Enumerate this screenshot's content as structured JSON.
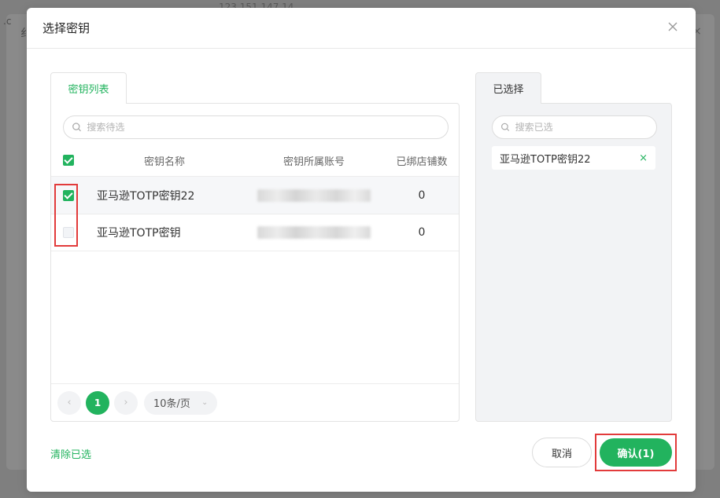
{
  "background": {
    "ip_text": "123.151.147.14",
    "left_text_1": ".c",
    "left_text_2": "纟",
    "right_text": "×"
  },
  "dialog": {
    "title": "选择密钥",
    "close_icon": "close-icon"
  },
  "left": {
    "tab_label": "密钥列表",
    "search_placeholder": "搜索待选",
    "columns": {
      "name": "密钥名称",
      "account": "密钥所属账号",
      "count": "已绑店铺数"
    },
    "rows": [
      {
        "checked": true,
        "name": "亚马逊TOTP密钥22",
        "count": "0"
      },
      {
        "checked": false,
        "name": "亚马逊TOTP密钥",
        "count": "0"
      }
    ],
    "pager": {
      "prev_icon": "‹",
      "current_page": "1",
      "next_icon": "›",
      "page_size": "10条/页",
      "page_size_arrow": "⌄"
    }
  },
  "right": {
    "tab_label": "已选择",
    "search_placeholder": "搜索已选",
    "selected": [
      {
        "name": "亚马逊TOTP密钥22",
        "remove": "×"
      }
    ]
  },
  "footer": {
    "clear_label": "清除已选",
    "cancel_label": "取消",
    "confirm_label": "确认(1)"
  },
  "colors": {
    "accent": "#22b35e",
    "highlight": "#e23b3b"
  }
}
